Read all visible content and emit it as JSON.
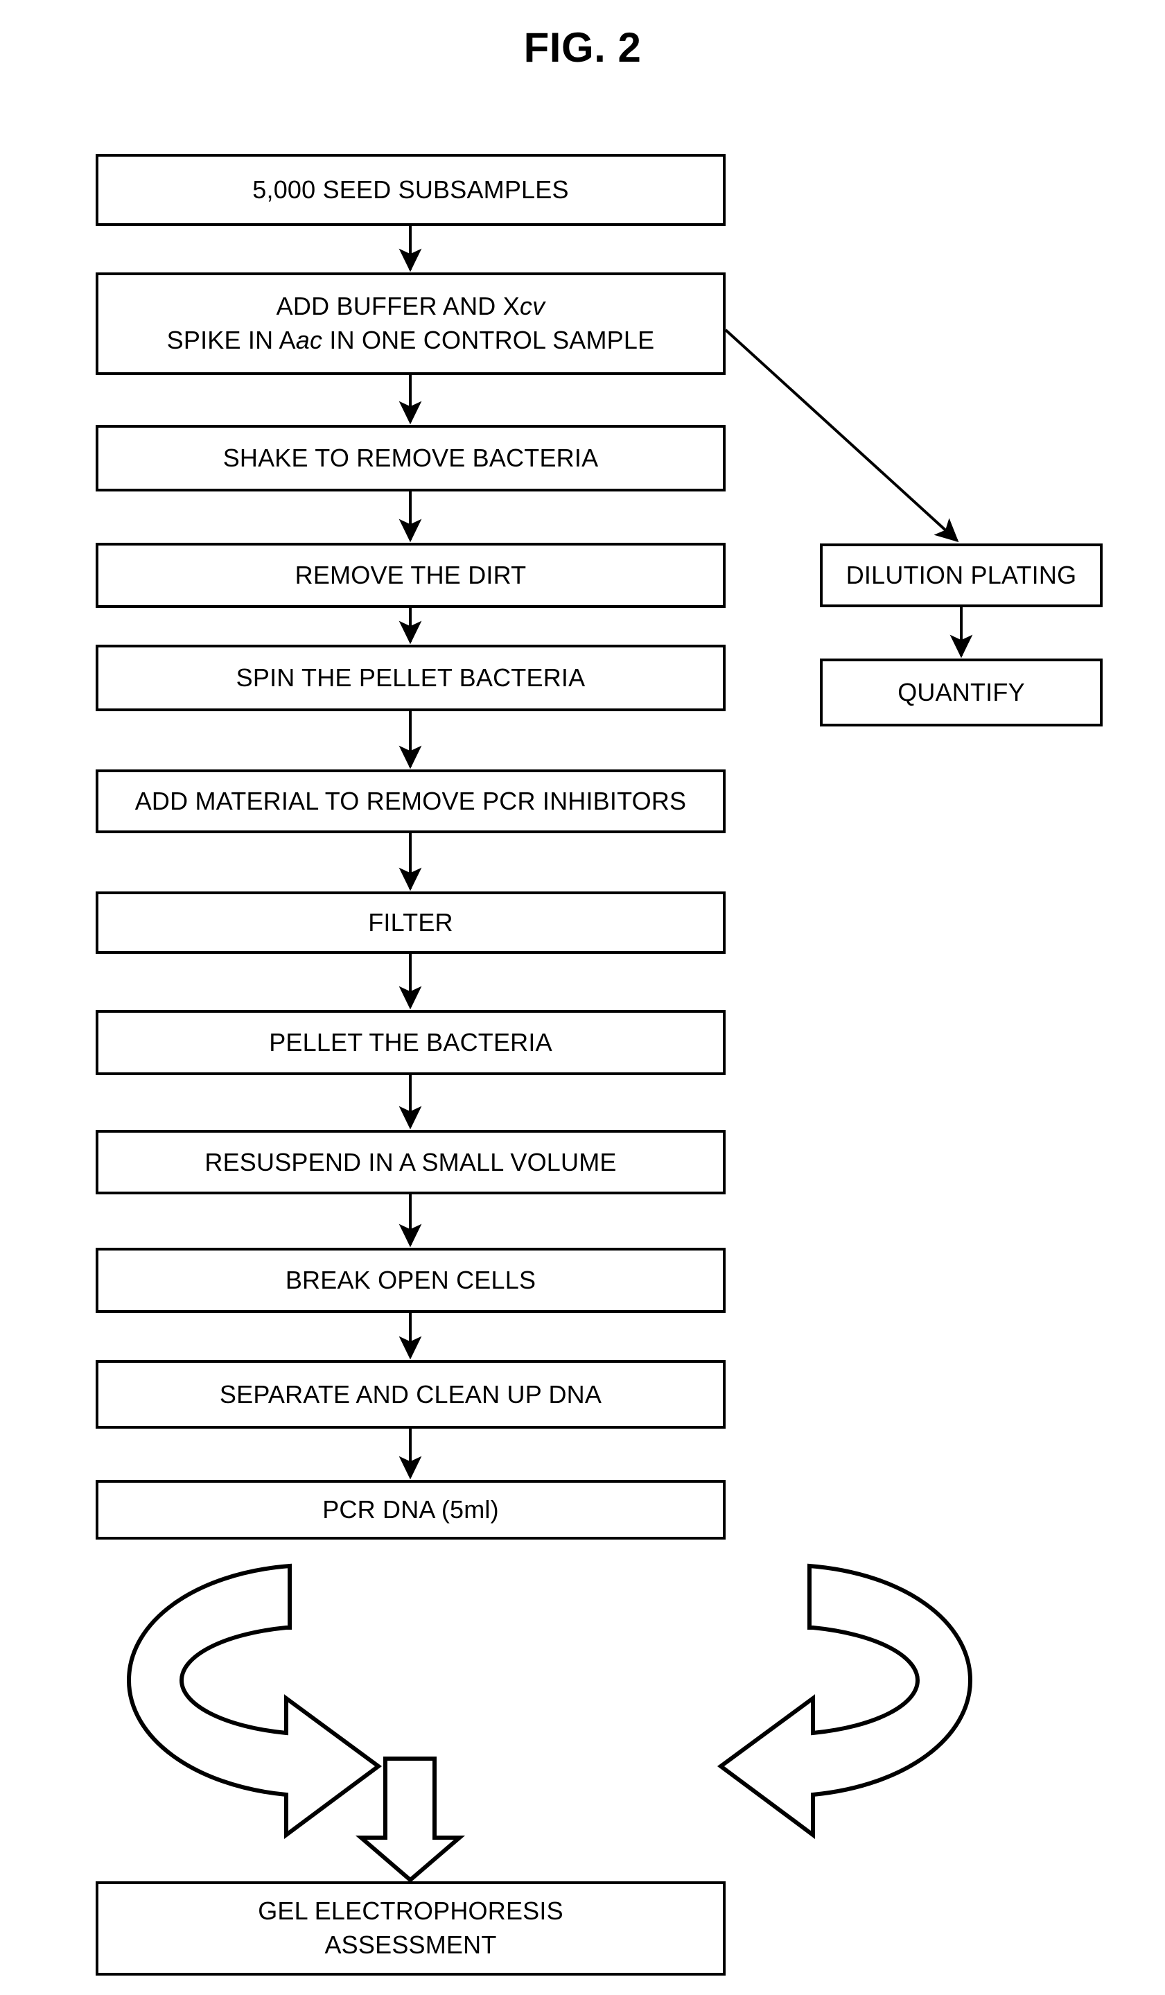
{
  "figure": {
    "title": "FIG. 2",
    "type": "process-flowchart",
    "ink_color": "#000000",
    "background_color": "#ffffff"
  },
  "main_flow": [
    {
      "id": "seed-subsamples",
      "label": "5,000 SEED SUBSAMPLES"
    },
    {
      "id": "add-buffer",
      "label_line1_a": "ADD BUFFER AND X",
      "label_line1_b": "cv",
      "label_line2_a": "SPIKE IN A",
      "label_line2_b": "ac",
      "label_line2_c": " IN ONE CONTROL SAMPLE",
      "label_plain": "ADD BUFFER AND Xcv / SPIKE IN Aac IN ONE CONTROL SAMPLE"
    },
    {
      "id": "shake",
      "label": "SHAKE TO REMOVE BACTERIA"
    },
    {
      "id": "remove-dirt",
      "label": "REMOVE THE DIRT"
    },
    {
      "id": "spin-pellet",
      "label": "SPIN THE PELLET BACTERIA"
    },
    {
      "id": "add-material",
      "label": "ADD MATERIAL TO REMOVE PCR INHIBITORS"
    },
    {
      "id": "filter",
      "label": "FILTER"
    },
    {
      "id": "pellet-bacteria",
      "label": "PELLET THE BACTERIA"
    },
    {
      "id": "resuspend",
      "label": "RESUSPEND IN A SMALL VOLUME"
    },
    {
      "id": "break-open-cells",
      "label": "BREAK OPEN CELLS"
    },
    {
      "id": "separate-clean",
      "label": "SEPARATE AND CLEAN UP DNA"
    },
    {
      "id": "pcr-dna",
      "label": "PCR DNA (5ml)"
    },
    {
      "id": "gel-electrophoresis",
      "label_line1": "GEL ELECTROPHORESIS",
      "label_line2": "ASSESSMENT",
      "label_plain": "GEL ELECTROPHORESIS ASSESSMENT"
    }
  ],
  "side_branch": [
    {
      "id": "dilution-plating",
      "label": "DILUTION PLATING"
    },
    {
      "id": "quantify",
      "label": "QUANTIFY"
    }
  ],
  "graphic": {
    "id": "recirculation-swirl",
    "description": "Two mirrored curved 3D arrows converging toward a downward hollow block arrow"
  }
}
